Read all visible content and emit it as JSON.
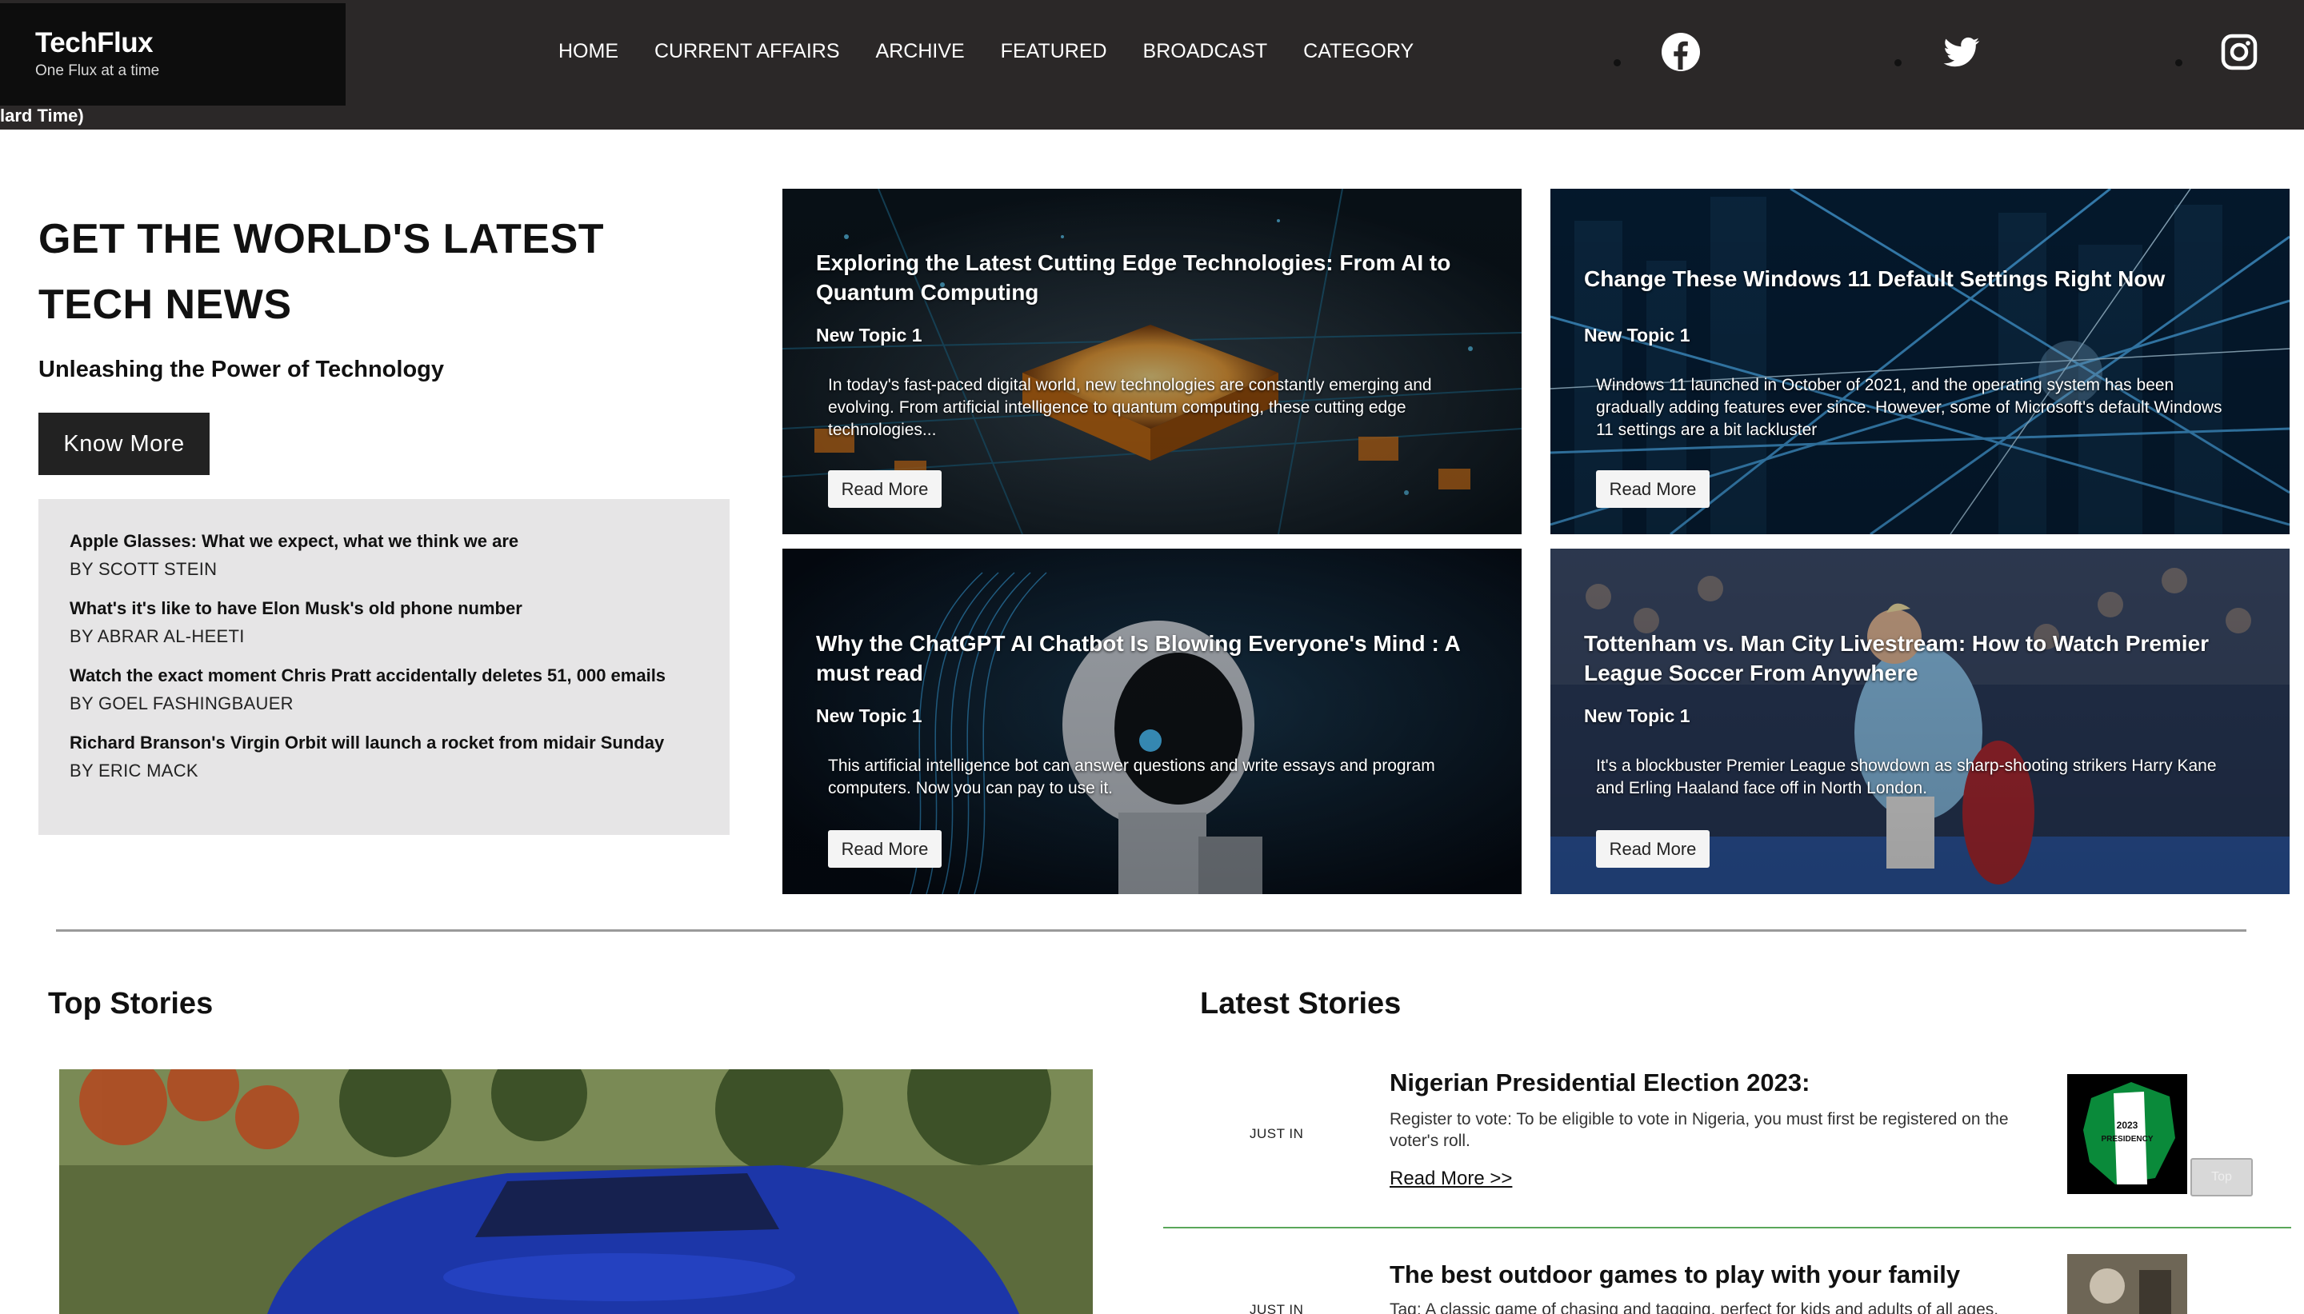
{
  "brand": {
    "name": "TechFlux",
    "tagline": "One Flux at a time"
  },
  "header": {
    "timezone_text": "lard Time)",
    "nav": [
      "HOME",
      "CURRENT AFFAIRS",
      "ARCHIVE",
      "FEATURED",
      "BROADCAST",
      "CATEGORY"
    ],
    "social_icons": [
      "facebook-icon",
      "twitter-icon",
      "instagram-icon"
    ]
  },
  "hero": {
    "title": "GET THE WORLD'S LATEST TECH NEWS",
    "subtitle": "Unleashing the Power of Technology",
    "button": "Know More",
    "headlines": [
      {
        "title": "Apple Glasses: What we expect, what we think we are",
        "byline": "BY SCOTT STEIN"
      },
      {
        "title": "What's it's like to have Elon Musk's old phone number",
        "byline": "BY ABRAR AL-HEETI"
      },
      {
        "title": "Watch the exact moment Chris Pratt accidentally deletes 51, 000 emails",
        "byline": "BY GOEL FASHINGBAUER"
      },
      {
        "title": "Richard Branson's Virgin Orbit will launch a rocket from midair Sunday",
        "byline": "BY ERIC MACK"
      }
    ]
  },
  "cards": [
    {
      "title": "Exploring the Latest Cutting Edge Technologies: From AI to Quantum Computing",
      "topic": "New Topic 1",
      "description": "In today's fast-paced digital world, new technologies are constantly emerging and evolving. From artificial intelligence to quantum computing, these cutting edge technologies...",
      "button": "Read More"
    },
    {
      "title": "Change These Windows 11 Default Settings Right Now",
      "topic": "New Topic 1",
      "description": "Windows 11 launched in October of 2021, and the operating system has been gradually adding features ever since. However, some of Microsoft's default Windows 11 settings are a bit lackluster",
      "button": "Read More"
    },
    {
      "title": "Why the ChatGPT AI Chatbot Is Blowing Everyone's Mind : A must read",
      "topic": "New Topic 1",
      "description": "This artificial intelligence bot can answer questions and write essays and program computers. Now you can pay to use it.",
      "button": "Read More"
    },
    {
      "title": "Tottenham vs. Man City Livestream: How to Watch Premier League Soccer From Anywhere",
      "topic": "New Topic 1",
      "description": "It's a blockbuster Premier League showdown as sharp-shooting strikers Harry Kane and Erling Haaland face off in North London.",
      "button": "Read More"
    }
  ],
  "top_stories": {
    "title": "Top Stories"
  },
  "latest_stories": {
    "title": "Latest Stories",
    "items": [
      {
        "tag": "JUST IN",
        "title": "Nigerian Presidential Election 2023:",
        "description": "Register to vote: To be eligible to vote in Nigeria, you must first be registered on the voter's roll.",
        "more": "Read More >>",
        "thumb_text": "2023 PRESIDENCY"
      },
      {
        "tag": "JUST IN",
        "title": "The best outdoor games to play with your family",
        "description": "Tag: A classic game of chasing and tagging, perfect for kids and adults of all ages."
      }
    ],
    "side_button": "Top"
  },
  "colors": {
    "header_bg": "#2b2828",
    "logo_bg": "#0d0d0d",
    "headline_panel_bg": "#e6e5e6",
    "divider_green": "#5aa75a"
  }
}
